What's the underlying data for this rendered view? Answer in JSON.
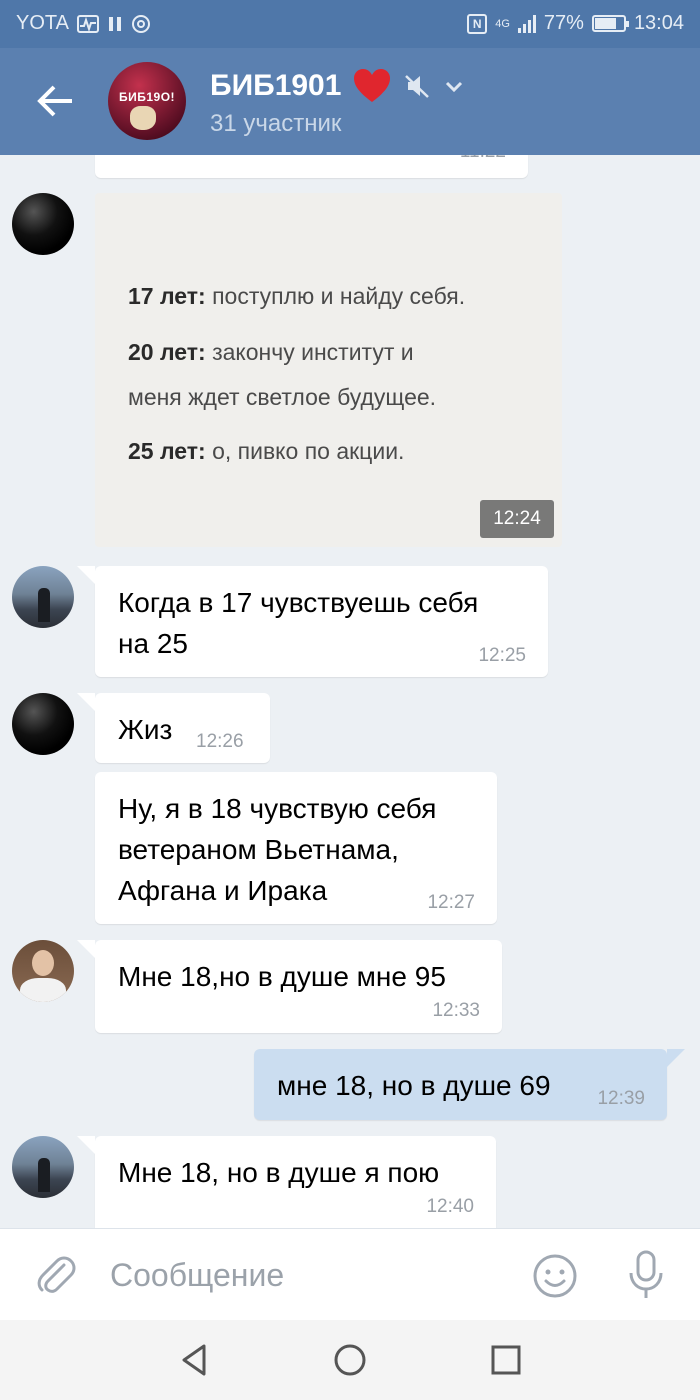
{
  "status_bar": {
    "carrier": "YOTA",
    "network": "4G",
    "battery": "77%",
    "battery_level": 0.77,
    "time": "13:04"
  },
  "header": {
    "title": "БИБ1901",
    "subtitle": "31 участник",
    "avatar_text": "БИБ19О!",
    "icons": [
      "back-arrow-icon",
      "heart-icon",
      "mute-icon",
      "chevron-down-icon"
    ],
    "colors": {
      "header": "#5b80b0",
      "statusbar": "#4f77a9",
      "heart": "#e0262e"
    }
  },
  "messages": {
    "partial_time": "11:22",
    "photo": {
      "lines": [
        {
          "bold": "17 лет:",
          "text": " поступлю и найду себя."
        },
        {
          "bold": "20 лет:",
          "text": " закончу институт и"
        },
        {
          "bold": "",
          "text": "меня ждет светлое будущее."
        },
        {
          "bold": "25 лет:",
          "text": " о, пивко по акции."
        }
      ],
      "time": "12:24"
    },
    "m1": {
      "lines": [
        "Когда в 17 чувствуешь себя",
        "на 25"
      ],
      "time": "12:25"
    },
    "m2": {
      "text": "Жиз",
      "time": "12:26"
    },
    "m3": {
      "lines": [
        "Ну, я в 18 чувствую себя",
        "ветераном Вьетнама,",
        "Афгана и Ирака"
      ],
      "time": "12:27"
    },
    "m4": {
      "text": "Мне 18,но в душе мне 95",
      "time": "12:33"
    },
    "m5": {
      "text": "мне 18, но в душе 69",
      "time": "12:39"
    },
    "m6": {
      "text": "Мне 18, но в душе я пою",
      "time": "12:40"
    }
  },
  "composer": {
    "placeholder": "Сообщение",
    "value": ""
  },
  "colors": {
    "own_bubble": "#cbddf0",
    "background": "#ecf0f4",
    "accent": "#5b80b0"
  }
}
